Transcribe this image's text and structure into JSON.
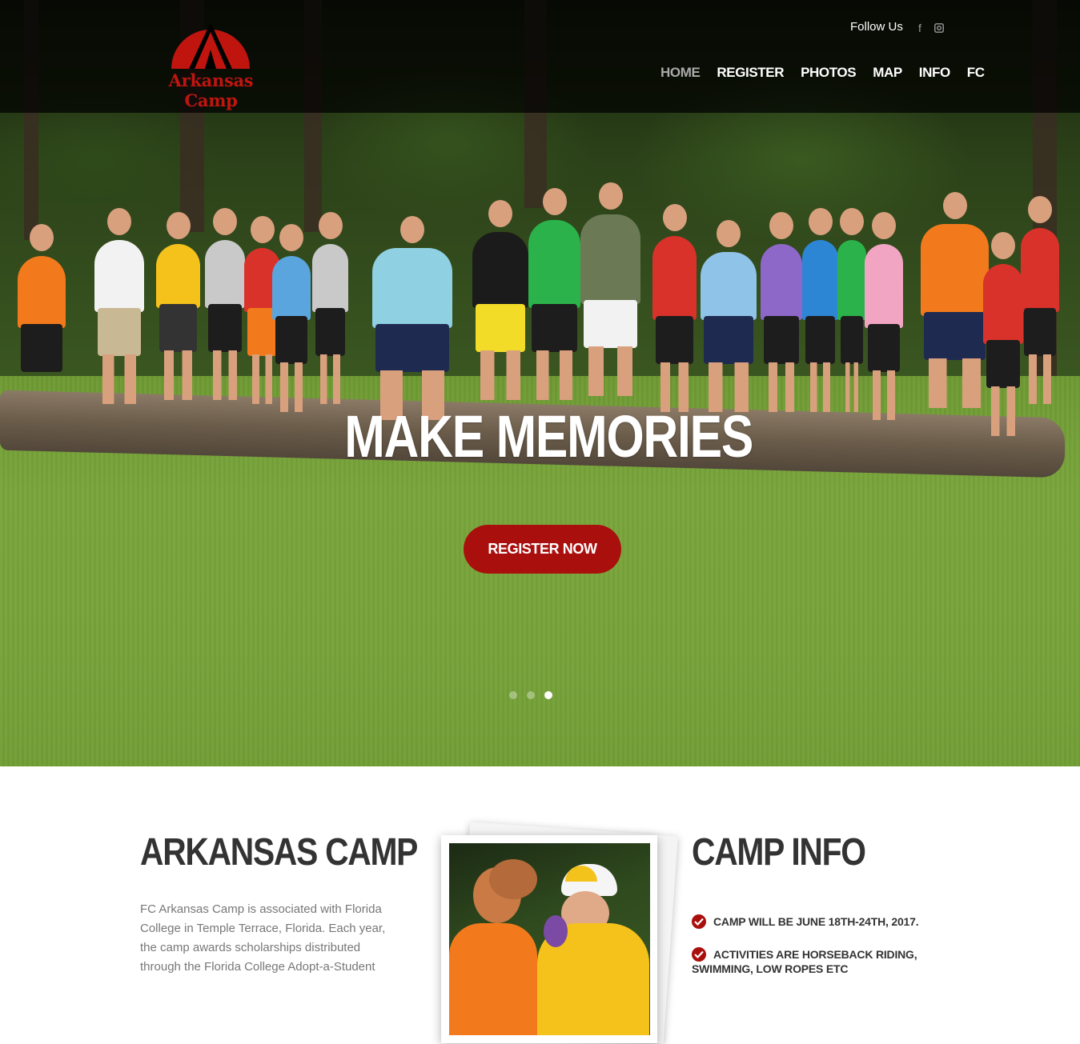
{
  "brand": {
    "name": "Arkansas Camp",
    "color": "#c0150f"
  },
  "header": {
    "follow_label": "Follow Us",
    "social": [
      {
        "name": "facebook-icon"
      },
      {
        "name": "instagram-icon"
      }
    ]
  },
  "nav": {
    "items": [
      {
        "label": "HOME",
        "active": true
      },
      {
        "label": "REGISTER",
        "active": false
      },
      {
        "label": "PHOTOS",
        "active": false
      },
      {
        "label": "MAP",
        "active": false
      },
      {
        "label": "INFO",
        "active": false
      },
      {
        "label": "FC",
        "active": false
      }
    ]
  },
  "hero": {
    "title": "MAKE MEMORIES",
    "cta_label": "REGISTER NOW",
    "cta_color": "#a90f0d",
    "slides_total": 3,
    "active_slide": 2
  },
  "about": {
    "title": "ARKANSAS CAMP",
    "body": "FC Arkansas Camp is associated with Florida College in Temple Terrace, Florida. Each year, the camp awards scholarships distributed through the Florida College Adopt-a-Student"
  },
  "info": {
    "title": "CAMP INFO",
    "items": [
      "CAMP WILL BE JUNE 18TH-24TH, 2017.",
      "ACTIVITIES ARE HORSEBACK RIDING, SWIMMING, LOW ROPES ETC"
    ]
  }
}
